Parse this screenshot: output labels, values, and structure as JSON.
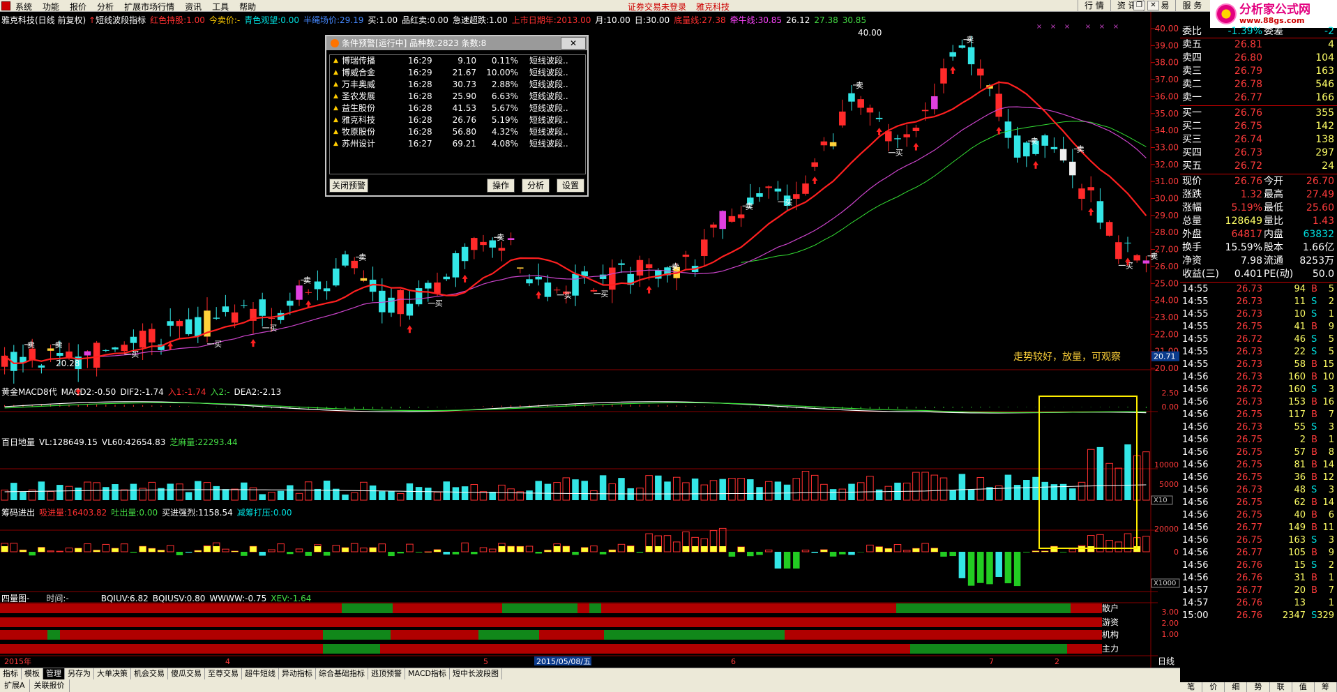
{
  "menubar": {
    "items": [
      "系统",
      "功能",
      "报价",
      "分析",
      "扩展市场行情",
      "资讯",
      "工具",
      "帮助"
    ],
    "status_login": "证券交易未登录",
    "status_stock": "雅克科技",
    "right_tabs": [
      "行 情",
      "资 讯",
      "交 易",
      "服 务"
    ]
  },
  "logo": {
    "text": "分析家公式网",
    "url_text": "www.88gs.com"
  },
  "main_header": {
    "stock": "雅克科技(日线 前复权)",
    "indicator": "短线波段指标",
    "items": [
      {
        "label": "红色持股:",
        "value": "1.00",
        "color": "#ff3030"
      },
      {
        "label": "今卖价:",
        "value": "-",
        "color": "#ffcc00"
      },
      {
        "label": "青色观望:",
        "value": "0.00",
        "color": "#00e0e0"
      },
      {
        "label": "半绳场价:",
        "value": "29.19",
        "color": "#4488ff"
      },
      {
        "label": "买:",
        "value": "1.00",
        "color": "#ffffff"
      },
      {
        "label": "品红卖:",
        "value": "0.00",
        "color": "#ffffff"
      },
      {
        "label": "急速超跌:",
        "value": "1.00",
        "color": "#ffffff"
      },
      {
        "label": "上市日期年:",
        "value": "2013.00",
        "color": "#ff3030"
      },
      {
        "label": "月:",
        "value": "10.00",
        "color": "#ffffff"
      },
      {
        "label": "日:",
        "value": "30.00",
        "color": "#ffffff"
      },
      {
        "label": "底量线:",
        "value": "27.38",
        "color": "#ff3030"
      },
      {
        "label": "牵牛线:",
        "value": "30.85",
        "color": "#ff44ff"
      },
      {
        "label": "",
        "value": "26.12",
        "color": "#ffffff"
      },
      {
        "label": "",
        "value": "27.38",
        "color": "#44dd44"
      },
      {
        "label": "",
        "value": "30.85",
        "color": "#44dd44"
      }
    ]
  },
  "price_axis": [
    "40.00",
    "39.00",
    "38.00",
    "37.00",
    "36.00",
    "35.00",
    "34.00",
    "33.00",
    "32.00",
    "31.00",
    "30.00",
    "29.00",
    "28.00",
    "27.00",
    "26.00",
    "25.00",
    "24.00",
    "23.00",
    "22.00",
    "21.00",
    "20.00"
  ],
  "price_label_low": "20.71",
  "annotation_max": "40.00",
  "annotation_min": "20.28",
  "annotation_text": "走势较好，放量，可观察",
  "signal_buy": "买",
  "signal_sell": "卖",
  "macd_header": {
    "title": "黄金MACD8代",
    "items": [
      {
        "label": "MACD2:",
        "value": "-0.50",
        "color": "#ffffff"
      },
      {
        "label": "DIF2:",
        "value": "-1.74",
        "color": "#ffffff"
      },
      {
        "label": "入1:",
        "value": "-1.74",
        "color": "#ff3030"
      },
      {
        "label": "入2:",
        "value": "-",
        "color": "#44dd44"
      },
      {
        "label": "DEA2:",
        "value": "-2.13",
        "color": "#ffffff"
      }
    ],
    "axis": [
      "2.50",
      "0.00"
    ]
  },
  "vol_header": {
    "title": "百日地量",
    "items": [
      {
        "label": "VL:",
        "value": "128649.15",
        "color": "#ffffff"
      },
      {
        "label": "VL60:",
        "value": "42654.83",
        "color": "#ffffff"
      },
      {
        "label": "芝麻量:",
        "value": "22293.44",
        "color": "#44dd44"
      }
    ],
    "axis": [
      "10000",
      "5000"
    ],
    "unit": "X10"
  },
  "chip_header": {
    "title": "筹码进出",
    "items": [
      {
        "label": "吸进量:",
        "value": "16403.82",
        "color": "#ff3030"
      },
      {
        "label": "吐出量:",
        "value": "0.00",
        "color": "#44dd44"
      },
      {
        "label": "买进强烈:",
        "value": "1158.54",
        "color": "#ffffff"
      },
      {
        "label": "减筹打压:",
        "value": "0.00",
        "color": "#00e0e0"
      }
    ],
    "axis": [
      "20000",
      "0"
    ],
    "unit": "X1000"
  },
  "four_header": {
    "title": "四量图-",
    "time_label": "时间:",
    "time_value": "-",
    "items": [
      {
        "label": "BQIUV:",
        "value": "6.82",
        "color": "#ffffff"
      },
      {
        "label": "BQIUSV:",
        "value": "0.80",
        "color": "#ffffff"
      },
      {
        "label": "WWWW:",
        "value": "-0.75",
        "color": "#ffffff"
      },
      {
        "label": "XEV:",
        "value": "-1.64",
        "color": "#44dd44"
      }
    ],
    "axis": [
      "3.00",
      "2.00",
      "1.00"
    ],
    "rows": [
      "散户",
      "游资",
      "机构",
      "主力"
    ]
  },
  "date_axis": {
    "labels": [
      "2015年",
      "4",
      "5",
      "6",
      "7",
      "2"
    ],
    "highlight": "2015/05/08/五",
    "period": "日线"
  },
  "alert_window": {
    "title": "条件预警[运行中] 品种数:2823 条数:8",
    "close": "✕",
    "rows": [
      {
        "name": "博瑞传播",
        "time": "16:29",
        "price": "9.10",
        "pct": "0.11%",
        "desc": "短线波段.."
      },
      {
        "name": "博威合金",
        "time": "16:29",
        "price": "21.67",
        "pct": "10.00%",
        "desc": "短线波段.."
      },
      {
        "name": "万丰奥威",
        "time": "16:28",
        "price": "30.73",
        "pct": "2.88%",
        "desc": "短线波段.."
      },
      {
        "name": "圣农发展",
        "time": "16:28",
        "price": "25.90",
        "pct": "6.63%",
        "desc": "短线波段.."
      },
      {
        "name": "益生股份",
        "time": "16:28",
        "price": "41.53",
        "pct": "5.67%",
        "desc": "短线波段.."
      },
      {
        "name": "雅克科技",
        "time": "16:28",
        "price": "26.76",
        "pct": "5.19%",
        "desc": "短线波段.."
      },
      {
        "name": "牧原股份",
        "time": "16:28",
        "price": "56.80",
        "pct": "4.32%",
        "desc": "短线波段.."
      },
      {
        "name": "苏州设计",
        "time": "16:27",
        "price": "69.21",
        "pct": "4.08%",
        "desc": "短线波段.."
      }
    ],
    "buttons": {
      "close_alert": "关闭预警",
      "operate": "操作",
      "analyze": "分析",
      "settings": "设置"
    }
  },
  "right_panel": {
    "top_row": {
      "l": "委比",
      "p": "-1.39%",
      "k": "委差",
      "v": "-2"
    },
    "sells": [
      {
        "label": "卖五",
        "price": "26.81",
        "vol": "4"
      },
      {
        "label": "卖四",
        "price": "26.80",
        "vol": "104"
      },
      {
        "label": "卖三",
        "price": "26.79",
        "vol": "163"
      },
      {
        "label": "卖二",
        "price": "26.78",
        "vol": "546"
      },
      {
        "label": "卖一",
        "price": "26.77",
        "vol": "166"
      }
    ],
    "buys": [
      {
        "label": "买一",
        "price": "26.76",
        "vol": "355"
      },
      {
        "label": "买二",
        "price": "26.75",
        "vol": "142"
      },
      {
        "label": "买三",
        "price": "26.74",
        "vol": "138"
      },
      {
        "label": "买四",
        "price": "26.73",
        "vol": "297"
      },
      {
        "label": "买五",
        "price": "26.72",
        "vol": "24"
      }
    ],
    "stats": [
      {
        "k1": "现价",
        "v1": "26.76",
        "k2": "今开",
        "v2": "26.70"
      },
      {
        "k1": "涨跌",
        "v1": "1.32",
        "k2": "最高",
        "v2": "27.49"
      },
      {
        "k1": "涨幅",
        "v1": "5.19%",
        "k2": "最低",
        "v2": "25.60"
      },
      {
        "k1": "总量",
        "v1": "128649",
        "k2": "量比",
        "v2": "1.43"
      },
      {
        "k1": "外盘",
        "v1": "64817",
        "k2": "内盘",
        "v2": "63832"
      },
      {
        "k1": "换手",
        "v1": "15.59%",
        "k2": "股本",
        "v2": "1.66亿"
      },
      {
        "k1": "净资",
        "v1": "7.98",
        "k2": "流通",
        "v2": "8253万"
      },
      {
        "k1": "收益(三)",
        "v1": "0.401",
        "k2": "PE(动)",
        "v2": "50.0"
      }
    ],
    "ticks": [
      {
        "t": "14:55",
        "p": "26.73",
        "v": "94",
        "b": "B",
        "n": "5"
      },
      {
        "t": "14:55",
        "p": "26.73",
        "v": "11",
        "b": "S",
        "n": "2"
      },
      {
        "t": "14:55",
        "p": "26.73",
        "v": "10",
        "b": "S",
        "n": "1"
      },
      {
        "t": "14:55",
        "p": "26.75",
        "v": "41",
        "b": "B",
        "n": "9"
      },
      {
        "t": "14:55",
        "p": "26.72",
        "v": "46",
        "b": "S",
        "n": "5"
      },
      {
        "t": "14:55",
        "p": "26.73",
        "v": "22",
        "b": "S",
        "n": "5"
      },
      {
        "t": "14:55",
        "p": "26.73",
        "v": "58",
        "b": "B",
        "n": "15"
      },
      {
        "t": "14:56",
        "p": "26.73",
        "v": "160",
        "b": "B",
        "n": "10"
      },
      {
        "t": "14:56",
        "p": "26.72",
        "v": "160",
        "b": "S",
        "n": "3"
      },
      {
        "t": "14:56",
        "p": "26.73",
        "v": "153",
        "b": "B",
        "n": "16"
      },
      {
        "t": "14:56",
        "p": "26.75",
        "v": "117",
        "b": "B",
        "n": "7"
      },
      {
        "t": "14:56",
        "p": "26.73",
        "v": "55",
        "b": "S",
        "n": "3"
      },
      {
        "t": "14:56",
        "p": "26.75",
        "v": "2",
        "b": "B",
        "n": "1"
      },
      {
        "t": "14:56",
        "p": "26.75",
        "v": "57",
        "b": "B",
        "n": "8"
      },
      {
        "t": "14:56",
        "p": "26.75",
        "v": "81",
        "b": "B",
        "n": "14"
      },
      {
        "t": "14:56",
        "p": "26.75",
        "v": "36",
        "b": "B",
        "n": "12"
      },
      {
        "t": "14:56",
        "p": "26.73",
        "v": "48",
        "b": "S",
        "n": "3"
      },
      {
        "t": "14:56",
        "p": "26.75",
        "v": "62",
        "b": "B",
        "n": "14"
      },
      {
        "t": "14:56",
        "p": "26.75",
        "v": "40",
        "b": "B",
        "n": "6"
      },
      {
        "t": "14:56",
        "p": "26.77",
        "v": "149",
        "b": "B",
        "n": "11"
      },
      {
        "t": "14:56",
        "p": "26.75",
        "v": "163",
        "b": "S",
        "n": "3"
      },
      {
        "t": "14:56",
        "p": "26.77",
        "v": "105",
        "b": "B",
        "n": "9"
      },
      {
        "t": "14:56",
        "p": "26.76",
        "v": "15",
        "b": "S",
        "n": "2"
      },
      {
        "t": "14:56",
        "p": "26.76",
        "v": "31",
        "b": "B",
        "n": "1"
      },
      {
        "t": "14:57",
        "p": "26.77",
        "v": "20",
        "b": "B",
        "n": "7"
      },
      {
        "t": "14:57",
        "p": "26.76",
        "v": "13",
        "b": "",
        "n": "1"
      },
      {
        "t": "15:00",
        "p": "26.76",
        "v": "2347",
        "b": "S",
        "n": "329"
      }
    ],
    "tabs": [
      "笔",
      "价",
      "细",
      "势",
      "联",
      "值",
      "筹"
    ]
  },
  "bottom_tabs": [
    "指标",
    "模板",
    "管理",
    "另存为",
    "大单决策",
    "机会交易",
    "傻瓜交易",
    "至尊交易",
    "超牛短线",
    "异动指标",
    "综合基础指标",
    "逃顶预警",
    "MACD指标",
    "短中长波段图"
  ],
  "bottom_tab_active": "管理",
  "status_bar": [
    "扩展A",
    "关联报价"
  ],
  "colors": {
    "up": "#ff2a2a",
    "down": "#33e6e6",
    "ma_red": "#ff2020",
    "ma_purple": "#cc44cc",
    "ma_green": "#33dd33",
    "highlight_box": "#ffee00"
  }
}
